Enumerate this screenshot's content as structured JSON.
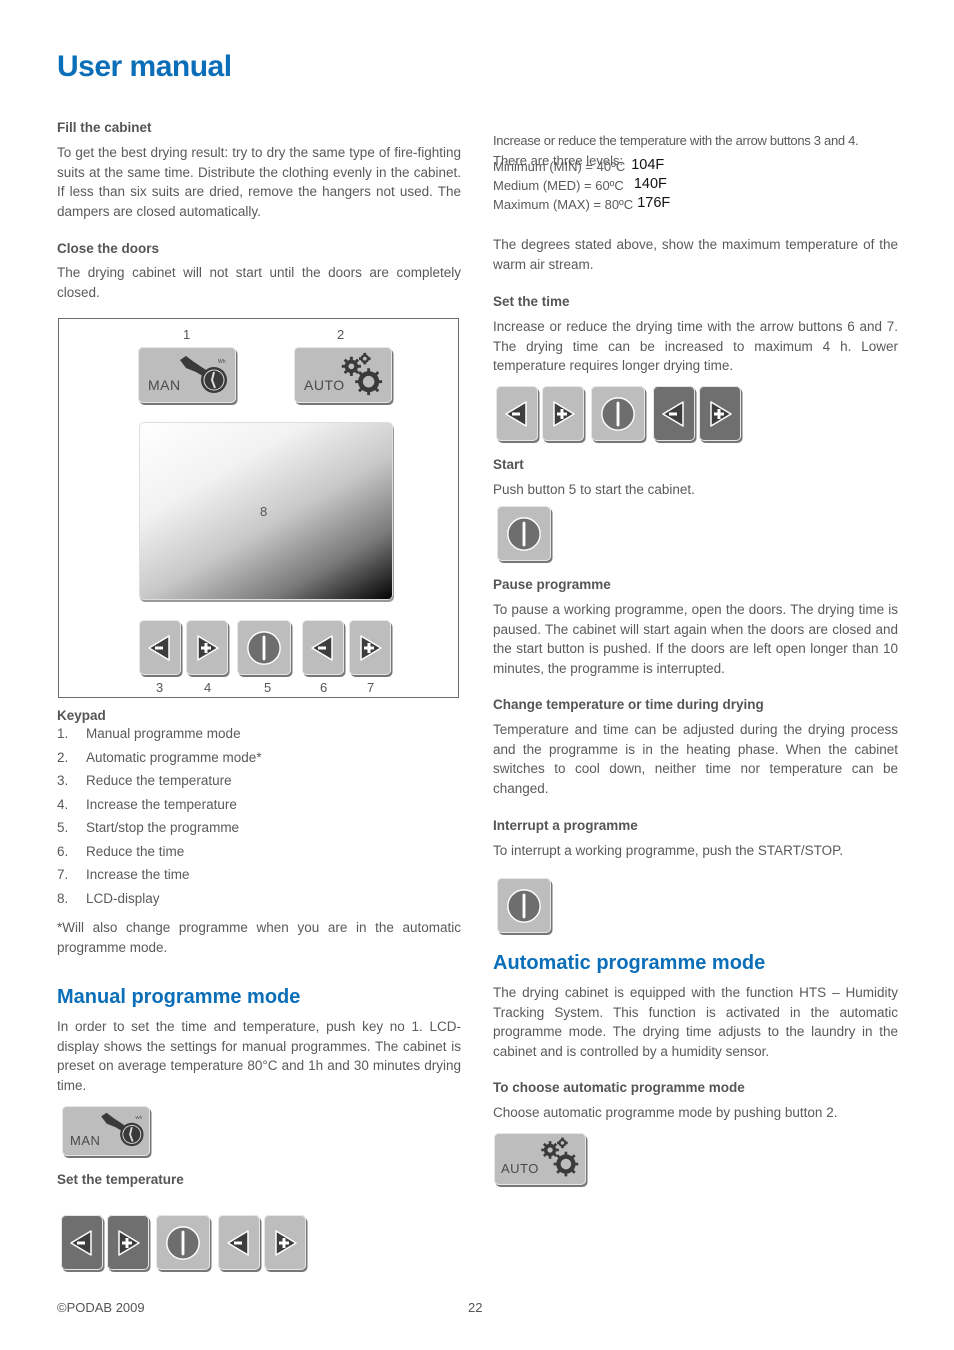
{
  "page": {
    "title": "User manual",
    "footer": {
      "copyright": "©PODAB 2009",
      "page_number": "22"
    }
  },
  "left": {
    "fill_cabinet": {
      "heading": "Fill the cabinet",
      "text": "To get the best drying result: try to dry the same type of fire-fighting suits at the same time. Distribute the clothing evenly in the cabinet. If less than six suits are dried, remove the hangers not used. The dampers are closed automatically."
    },
    "close_doors": {
      "heading": "Close the doors",
      "text": "The drying cabinet will not start until the doors are completely closed."
    },
    "figure": {
      "labels": [
        "1",
        "2",
        "3",
        "4",
        "5",
        "6",
        "7",
        "8"
      ],
      "man_label": "MAN",
      "auto_label": "AUTO"
    },
    "keypad": {
      "heading": "Keypad",
      "items": [
        {
          "n": "1.",
          "label": "Manual programme mode"
        },
        {
          "n": "2.",
          "label": "Automatic programme mode*"
        },
        {
          "n": "3.",
          "label": "Reduce the temperature"
        },
        {
          "n": "4.",
          "label": "Increase the temperature"
        },
        {
          "n": "5.",
          "label": "Start/stop the programme"
        },
        {
          "n": "6.",
          "label": "Reduce the time"
        },
        {
          "n": "7.",
          "label": "Increase the time"
        },
        {
          "n": "8.",
          "label": "LCD-display"
        }
      ],
      "footnote": "*Will also change programme when you are in the automatic programme mode."
    },
    "manual_mode": {
      "heading": "Manual programme mode",
      "text": "In order to set the time and temperature, push key no 1. LCD-display shows the settings for manual programmes. The cabinet is preset on average temperature 80°C and 1h and 30 minutes drying time.",
      "button_label": "MAN"
    },
    "set_temperature": {
      "heading": "Set the temperature"
    }
  },
  "right": {
    "temperature": {
      "intro": "Increase or reduce the temperature with the arrow buttons 3 and 4.",
      "levels_label": "There are three levels:",
      "levels": [
        {
          "label": "Minimum (MIN) = 40ºC",
          "fahrenheit": "104F"
        },
        {
          "label": "Medium (MED) = 60ºC",
          "fahrenheit": "140F"
        },
        {
          "label": "Maximum (MAX) = 80ºC",
          "fahrenheit": "176F"
        }
      ],
      "note": "The degrees stated above, show the maximum temperature of the warm air stream."
    },
    "set_time": {
      "heading": "Set the time",
      "text": "Increase or reduce the drying time with the arrow buttons 6 and 7. The drying time can be increased to maximum 4 h. Lower temperature requires longer drying time."
    },
    "start": {
      "heading": "Start",
      "text": "Push button 5 to start the cabinet."
    },
    "pause": {
      "heading": "Pause programme",
      "text": "To pause a working programme, open the doors. The drying time is paused. The cabinet will start again when the doors are closed and the start button is pushed. If the doors are left open longer than 10 minutes, the programme is interrupted."
    },
    "change": {
      "heading": "Change temperature or time during drying",
      "text": "Temperature and time can be adjusted during the drying process and the programme is in the heating phase. When the cabinet switches to cool down, neither time nor temperature can be changed."
    },
    "interrupt": {
      "heading": "Interrupt a programme",
      "text": "To interrupt a working programme, push the START/STOP."
    },
    "auto_mode": {
      "heading": "Automatic programme mode",
      "text": "The drying cabinet is equipped with the function HTS – Humidity Tracking System. This function is activated in the automatic programme mode. The drying time adjusts to the laundry in the cabinet and is controlled by a humidity sensor.",
      "sub_heading": "To choose automatic programme mode",
      "sub_text": "Choose automatic programme mode by pushing button 2.",
      "button_label": "AUTO"
    }
  },
  "colors": {
    "accent": "#0a6eb8",
    "text": "#5a5a5a",
    "key_light": "#bdbdbd",
    "key_dark": "#6f6f6f"
  }
}
